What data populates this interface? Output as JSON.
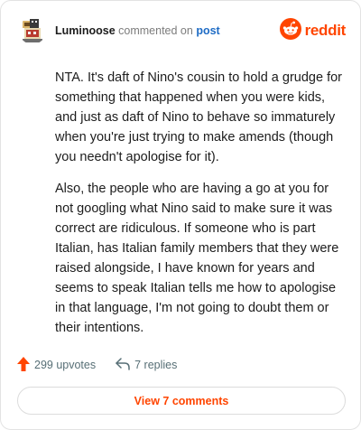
{
  "header": {
    "username": "Luminoose",
    "action_text": "commented on",
    "post_link": "post",
    "brand_name": "reddit",
    "brand_color": "#ff4500"
  },
  "comment": {
    "paragraphs": [
      "NTA. It's daft of Nino's cousin to hold a grudge for something that happened when you were kids, and just as daft of Nino to behave so immaturely when you're just trying to make amends (though you needn't apologise for it).",
      "Also, the people who are having a go at you for not googling what Nino said to make sure it was correct are ridiculous. If someone who is part Italian, has Italian family members that they were raised alongside, I have known for years and seems to speak Italian tells me how to apologise in that language, I'm not going to doubt them or their intentions."
    ]
  },
  "footer": {
    "upvotes": "299 upvotes",
    "replies": "7 replies",
    "upvote_icon": "upvote-arrow-icon",
    "reply_icon": "reply-icon"
  },
  "view_button": {
    "label": "View 7 comments"
  }
}
